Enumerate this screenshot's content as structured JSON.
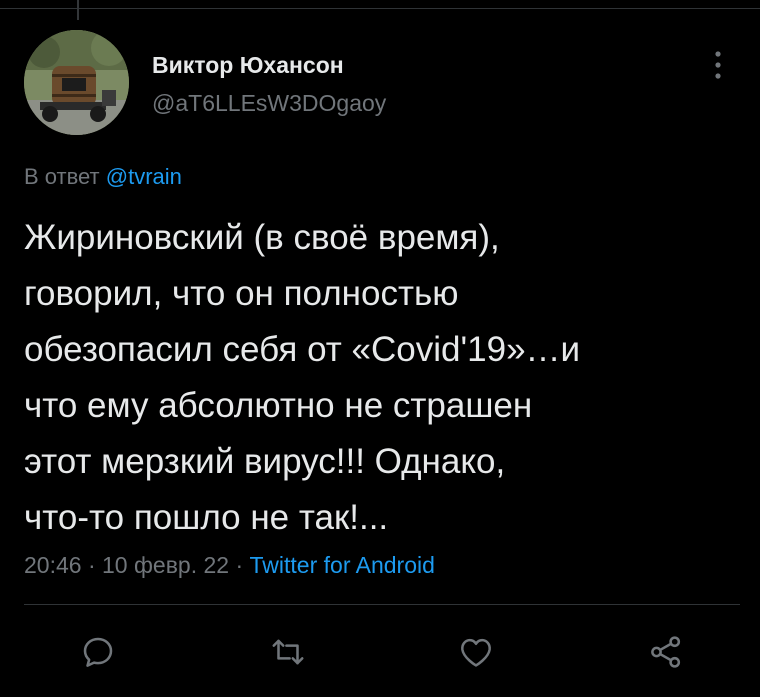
{
  "tweet": {
    "author": {
      "display_name": "Виктор Юхансон",
      "handle": "@aT6LLEsW3DOgaoy"
    },
    "reply_prefix": "В ответ",
    "reply_to": "@tvrain",
    "text": "Жириновский (в своё время),\nговорил, что он полностью\nобезопасил себя от «Covid'19»…и\nчто ему абсолютно не страшен\nэтот мерзкий вирус!!! Однако,\nчто-то пошло не так!...",
    "time": "20:46",
    "separator": " · ",
    "date": "10 февр. 22",
    "source": "Twitter for Android"
  },
  "actions": {
    "reply_icon": "reply-icon",
    "retweet_icon": "retweet-icon",
    "like_icon": "like-icon",
    "share_icon": "share-icon"
  },
  "colors": {
    "background": "#000000",
    "text": "#e7e9ea",
    "muted": "#71767b",
    "link": "#1d9bf0",
    "divider": "#2f3336"
  }
}
